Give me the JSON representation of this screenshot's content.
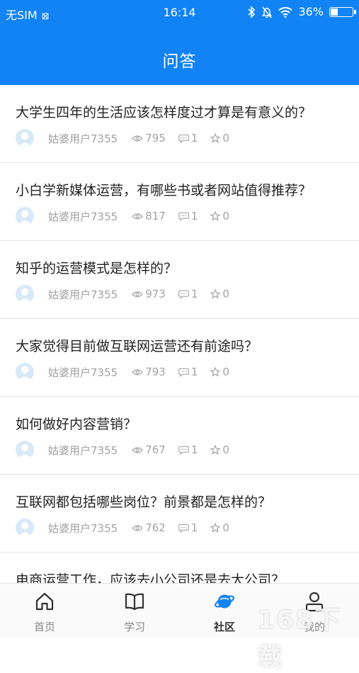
{
  "status_bar": {
    "carrier": "无SIM",
    "time": "16:14",
    "battery_percent": "36%",
    "battery_level": 0.36,
    "icons": [
      "sim-icon",
      "bluetooth-icon",
      "mute-bell-icon",
      "wifi-icon",
      "battery-icon"
    ]
  },
  "header": {
    "title": "问答"
  },
  "questions": [
    {
      "title": "大学生四年的生活应该怎样度过才算是有意义的？",
      "user": "姑婆用户7355",
      "views": "795",
      "comments": "1",
      "likes": "0"
    },
    {
      "title": "小白学新媒体运营，有哪些书或者网站值得推荐？",
      "user": "姑婆用户7355",
      "views": "817",
      "comments": "1",
      "likes": "0"
    },
    {
      "title": "知乎的运营模式是怎样的？",
      "user": "姑婆用户7355",
      "views": "973",
      "comments": "1",
      "likes": "0"
    },
    {
      "title": "大家觉得目前做互联网运营还有前途吗？",
      "user": "姑婆用户7355",
      "views": "793",
      "comments": "1",
      "likes": "0"
    },
    {
      "title": "如何做好内容营销？",
      "user": "姑婆用户7355",
      "views": "767",
      "comments": "1",
      "likes": "0"
    },
    {
      "title": "互联网都包括哪些岗位？前景都是怎样的？",
      "user": "姑婆用户7355",
      "views": "762",
      "comments": "1",
      "likes": "0"
    },
    {
      "title": "电商运营工作，应该去小公司还是去大公司？",
      "user": "",
      "views": "",
      "comments": "",
      "likes": ""
    }
  ],
  "tabs": [
    {
      "label": "首页",
      "icon": "home-icon",
      "active": false
    },
    {
      "label": "学习",
      "icon": "book-icon",
      "active": false
    },
    {
      "label": "社区",
      "icon": "planet-icon",
      "active": true
    },
    {
      "label": "我的",
      "icon": "profile-icon",
      "active": false
    }
  ],
  "watermark": {
    "text": "168下载",
    "url": "www.downza.cn"
  },
  "colors": {
    "brand": "#1183f5",
    "text": "#222222",
    "meta": "#a2a2a2",
    "divider": "#e4e4e4"
  }
}
